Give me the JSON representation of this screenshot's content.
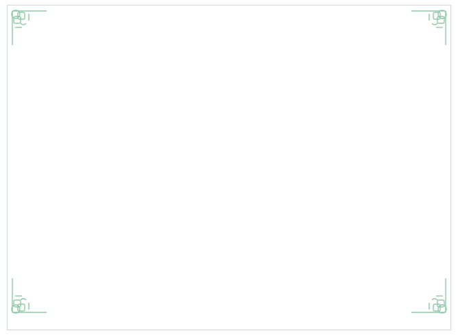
{
  "page": {
    "background": "#ffffff",
    "border_color": "#cfd8d3",
    "ornament_color": "#8fcaa6"
  },
  "ornaments": [
    {
      "id": "top-left",
      "icon": "celtic-knot-corner-icon"
    },
    {
      "id": "top-right",
      "icon": "celtic-knot-corner-icon"
    },
    {
      "id": "bottom-left",
      "icon": "celtic-knot-corner-icon"
    },
    {
      "id": "bottom-right",
      "icon": "celtic-knot-corner-icon"
    }
  ]
}
